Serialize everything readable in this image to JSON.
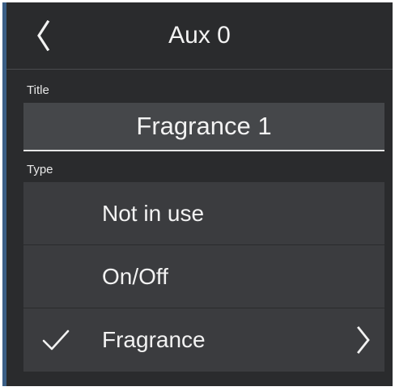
{
  "header": {
    "title": "Aux 0",
    "back_icon": "chevron-left-icon"
  },
  "title_section": {
    "label": "Title",
    "value": "Fragrance 1"
  },
  "type_section": {
    "label": "Type",
    "options": [
      {
        "label": "Not in use",
        "selected": false
      },
      {
        "label": "On/Off",
        "selected": false
      },
      {
        "label": "Fragrance",
        "selected": true,
        "has_submenu": true
      }
    ]
  },
  "colors": {
    "background": "#2a2b2d",
    "field": "#45474a",
    "option": "#3b3c3f",
    "text": "#f2f2f2",
    "accent_edge": "#3b5f86"
  }
}
